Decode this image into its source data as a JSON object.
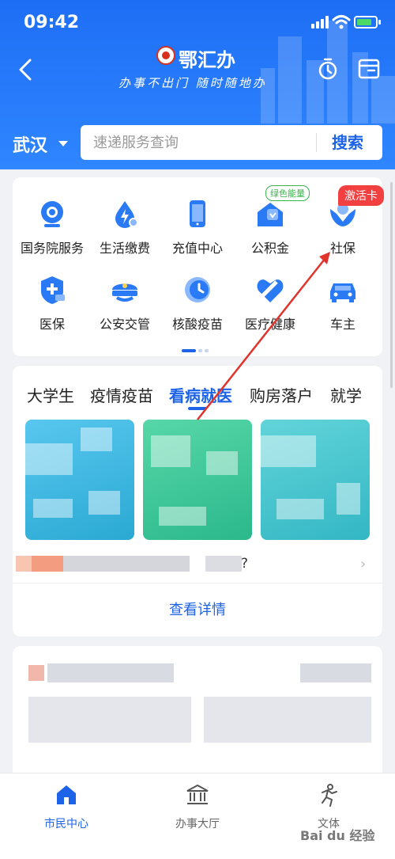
{
  "status_bar": {
    "time": "09:42"
  },
  "header": {
    "app_title": "鄂汇办",
    "slogan": "办事不出门 随时随地办",
    "city": "武汉",
    "search": {
      "placeholder": "速递服务查询",
      "button_label": "搜索"
    }
  },
  "services": {
    "items": [
      {
        "label": "国务院服务",
        "icon": "state-council-icon"
      },
      {
        "label": "生活缴费",
        "icon": "utility-payment-icon"
      },
      {
        "label": "充值中心",
        "icon": "phone-recharge-icon"
      },
      {
        "label": "公积金",
        "icon": "housing-fund-icon",
        "badge": "绿色能量"
      },
      {
        "label": "社保",
        "icon": "social-security-icon",
        "badge": "激活卡"
      },
      {
        "label": "医保",
        "icon": "medical-insurance-icon"
      },
      {
        "label": "公安交管",
        "icon": "police-cap-icon"
      },
      {
        "label": "核酸疫苗",
        "icon": "nucleic-vaccine-icon"
      },
      {
        "label": "医疗健康",
        "icon": "healthcare-icon"
      },
      {
        "label": "车主",
        "icon": "car-icon"
      }
    ],
    "page_index": 1,
    "page_count": 3
  },
  "categories": {
    "tabs": [
      "大学生",
      "疫情疫苗",
      "看病就医",
      "购房落户",
      "就学"
    ],
    "active": "看病就医",
    "notice_suffix": "?",
    "view_details": "查看详情"
  },
  "tabbar": {
    "items": [
      {
        "label": "市民中心",
        "icon": "home-icon",
        "active": true
      },
      {
        "label": "办事大厅",
        "icon": "government-hall-icon",
        "active": false
      },
      {
        "label": "文体",
        "icon": "running-person-icon",
        "active": false
      }
    ]
  },
  "watermark": "Bai du 经验",
  "colors": {
    "primary": "#1d63e8",
    "header_bg": "#2f86ff",
    "badge_red": "#f23f3f",
    "badge_green": "#39b54a",
    "annotation_arrow": "#e0332b"
  }
}
